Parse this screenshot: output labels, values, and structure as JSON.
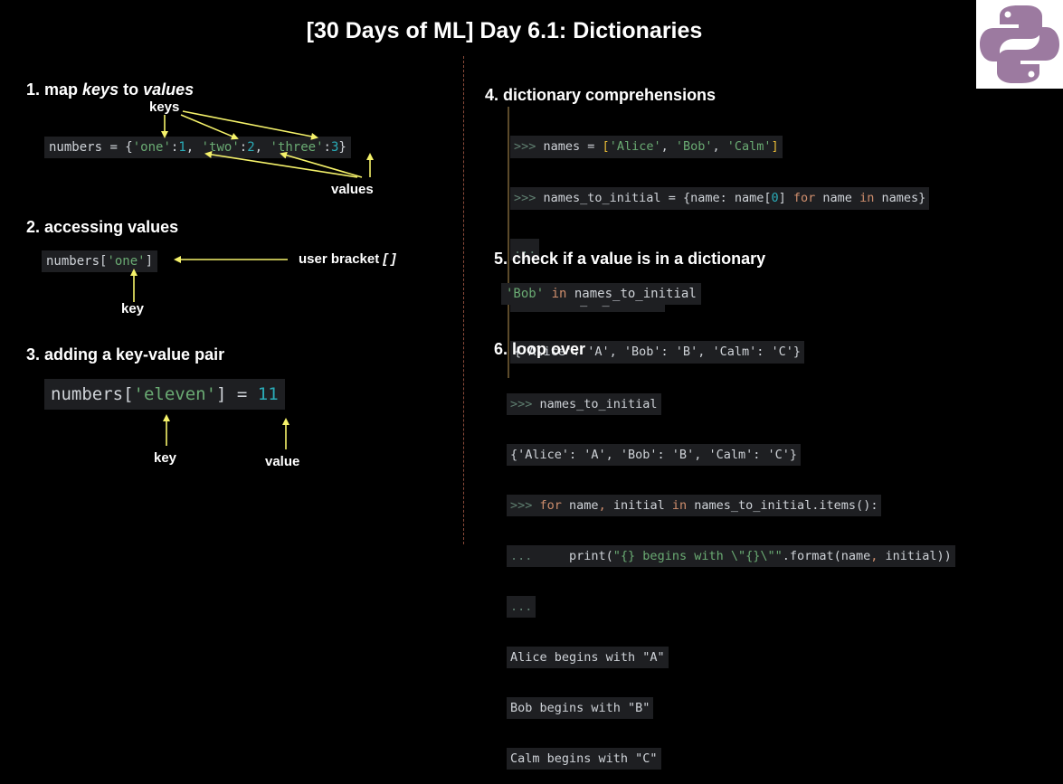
{
  "title": "[30 Days of ML] Day 6.1: Dictionaries",
  "logo_icon": "python-logo-icon",
  "colors": {
    "arrow": "#f5f26a",
    "string": "#6aab73",
    "number": "#2aacb8",
    "keyword": "#cf8e6d",
    "code_bg": "#1e1f22"
  },
  "section1": {
    "heading_num": "1. map ",
    "heading_keys": "keys",
    "heading_to": " to ",
    "heading_values": "values",
    "code": {
      "var": "numbers",
      "eq": " = {",
      "k1": "'one'",
      "v1": "1",
      "k2": "'two'",
      "v2": "2",
      "k3": "'three'",
      "v3": "3",
      "close": "}"
    },
    "label_keys": "keys",
    "label_values": "values"
  },
  "section2": {
    "heading": "2. accessing values",
    "code": {
      "var": "numbers[",
      "key": "'one'",
      "close": "]"
    },
    "label_bracket": "user bracket ",
    "label_bracket_sym": "[ ]",
    "label_key": "key"
  },
  "section3": {
    "heading": "3. adding a key-value pair",
    "code": {
      "var": "numbers[",
      "key": "'eleven'",
      "mid": "] = ",
      "value": "11"
    },
    "label_key": "key",
    "label_value": "value"
  },
  "section4": {
    "heading": "4. dictionary comprehensions",
    "prompt": ">>>",
    "cont": "...",
    "line1": {
      "a": " names = ",
      "lb": "[",
      "s1": "'Alice'",
      "c1": ", ",
      "s2": "'Bob'",
      "c2": ", ",
      "s3": "'Calm'",
      "rb": "]"
    },
    "line2": {
      "a": " names_to_initial = {name: name[",
      "idx": "0",
      "b": "] ",
      "for": "for",
      "c": " name ",
      "in": "in",
      "d": " names}"
    },
    "line4": " names_to_initial",
    "line5": "{'Alice': 'A', 'Bob': 'B', 'Calm': 'C'}"
  },
  "section5": {
    "heading": "5. check if a value is in a dictionary",
    "code": {
      "str": "'Bob'",
      "in": " in",
      "rest": " names_to_initial"
    }
  },
  "section6": {
    "heading": "6. loop over",
    "prompt": ">>>",
    "cont": "...",
    "line1": " names_to_initial",
    "line2": "{'Alice': 'A', 'Bob': 'B', 'Calm': 'C'}",
    "line3": {
      "sp": " ",
      "for": "for",
      "a": " name",
      "c": ",",
      "b": " initial ",
      "in": "in",
      "d": " names_to_initial.items():"
    },
    "line4": {
      "a": "     print(",
      "str": "\"{} begins with \\\"{}\\\"\"",
      "b": ".format(name",
      "c": ",",
      "d": " initial))"
    },
    "out1": "Alice begins with \"A\"",
    "out2": "Bob begins with \"B\"",
    "out3": "Calm begins with \"C\""
  }
}
